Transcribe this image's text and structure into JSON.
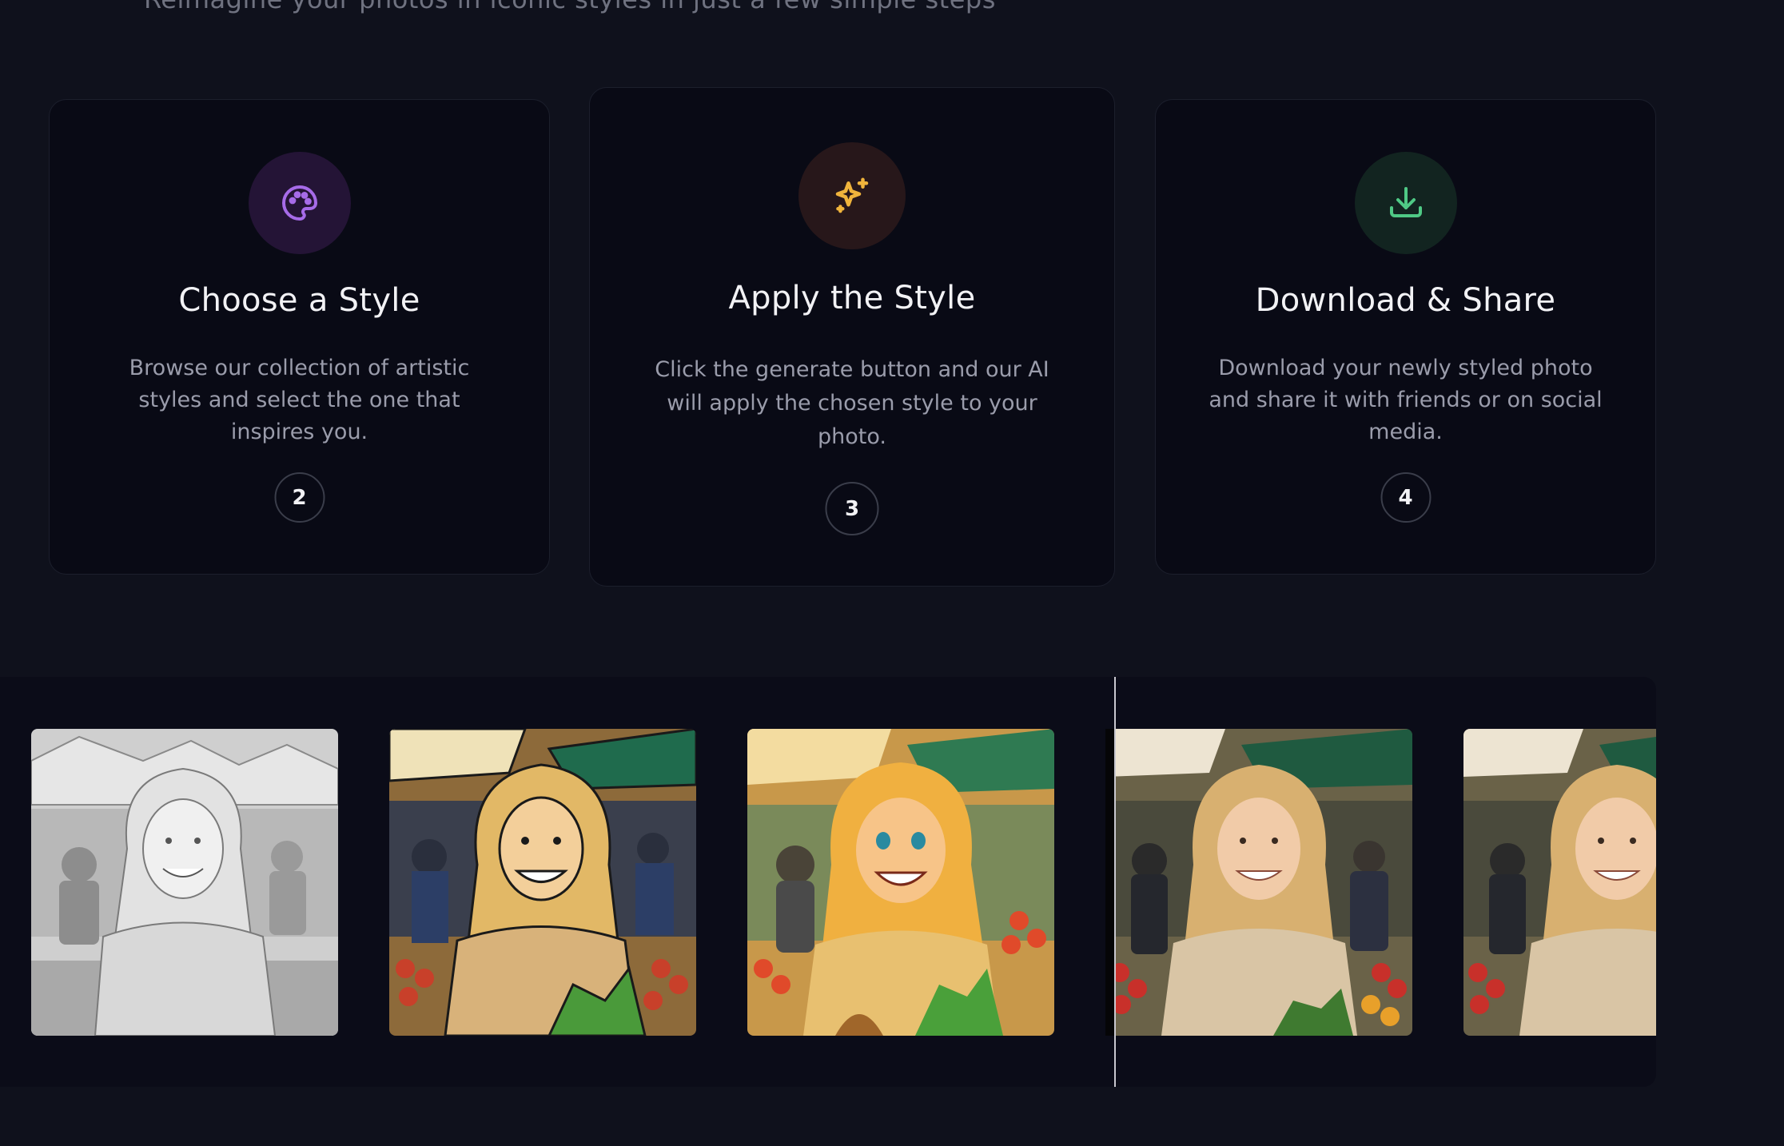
{
  "section": {
    "subtitle": "Reimagine your photos in iconic styles in just a few simple steps"
  },
  "steps": [
    {
      "icon": "palette-icon",
      "icon_color": "#a66be8",
      "title": "Choose a Style",
      "description": "Browse our collection of artistic styles and select the one that inspires you.",
      "number": "2"
    },
    {
      "icon": "sparkles-icon",
      "icon_color": "#f0b43c",
      "title": "Apply the Style",
      "description": "Click the generate button and our AI will apply the chosen style to your photo.",
      "number": "3"
    },
    {
      "icon": "download-icon",
      "icon_color": "#4fc985",
      "title": "Download & Share",
      "description": "Download your newly styled photo and share it with friends or on social media.",
      "number": "4"
    }
  ],
  "gallery": {
    "images": [
      {
        "style": "pencil-sketch"
      },
      {
        "style": "ink-illustration"
      },
      {
        "style": "animated-cartoon"
      },
      {
        "style": "original-photo"
      },
      {
        "style": "original-photo"
      }
    ]
  }
}
